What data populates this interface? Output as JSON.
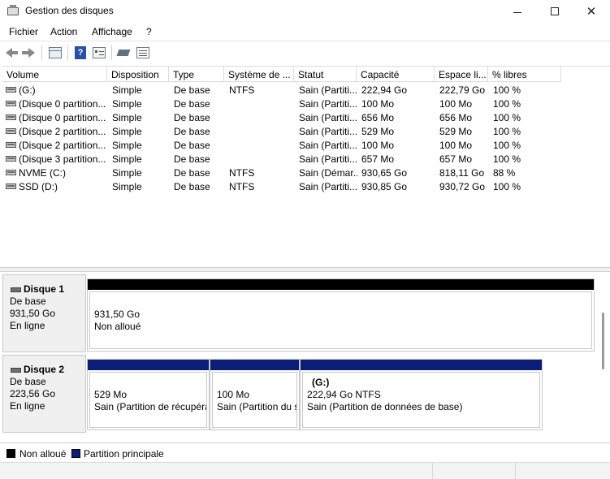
{
  "window": {
    "title": "Gestion des disques",
    "minimize_label": "—",
    "close_label": "✕"
  },
  "menu": [
    "Fichier",
    "Action",
    "Affichage",
    "?"
  ],
  "table": {
    "columns": [
      "Volume",
      "Disposition",
      "Type",
      "Système de ...",
      "Statut",
      "Capacité",
      "Espace li...",
      "% libres"
    ],
    "rows": [
      [
        "(G:)",
        "Simple",
        "De base",
        "NTFS",
        "Sain (Partiti...",
        "222,94 Go",
        "222,79 Go",
        "100 %"
      ],
      [
        "(Disque 0 partition...",
        "Simple",
        "De base",
        "",
        "Sain (Partiti...",
        "100 Mo",
        "100 Mo",
        "100 %"
      ],
      [
        "(Disque 0 partition...",
        "Simple",
        "De base",
        "",
        "Sain (Partiti...",
        "656 Mo",
        "656 Mo",
        "100 %"
      ],
      [
        "(Disque 2 partition...",
        "Simple",
        "De base",
        "",
        "Sain (Partiti...",
        "529 Mo",
        "529 Mo",
        "100 %"
      ],
      [
        "(Disque 2 partition...",
        "Simple",
        "De base",
        "",
        "Sain (Partiti...",
        "100 Mo",
        "100 Mo",
        "100 %"
      ],
      [
        "(Disque 3 partition...",
        "Simple",
        "De base",
        "",
        "Sain (Partiti...",
        "657 Mo",
        "657 Mo",
        "100 %"
      ],
      [
        "NVME (C:)",
        "Simple",
        "De base",
        "NTFS",
        "Sain (Démar...",
        "930,65 Go",
        "818,11 Go",
        "88 %"
      ],
      [
        "SSD (D:)",
        "Simple",
        "De base",
        "NTFS",
        "Sain (Partiti...",
        "930,85 Go",
        "930,72 Go",
        "100 %"
      ]
    ]
  },
  "disks": [
    {
      "name": "Disque 1",
      "type": "De base",
      "size": "931,50 Go",
      "status": "En ligne",
      "partitions": [
        {
          "title": "",
          "size": "931,50 Go",
          "desc": "Non alloué",
          "bar_color": "#000000"
        }
      ]
    },
    {
      "name": "Disque 2",
      "type": "De base",
      "size": "223,56 Go",
      "status": "En ligne",
      "partitions": [
        {
          "title": "",
          "size": "529 Mo",
          "desc": "Sain (Partition de récupéra",
          "bar_color": "#0a1e78"
        },
        {
          "title": "",
          "size": "100 Mo",
          "desc": "Sain (Partition du s",
          "bar_color": "#0a1e78"
        },
        {
          "title": "(G:)",
          "size": "222,94 Go NTFS",
          "desc": "Sain (Partition de données de base)",
          "bar_color": "#0a1e78"
        }
      ]
    }
  ],
  "legend": [
    {
      "label": "Non alloué",
      "color": "#000000"
    },
    {
      "label": "Partition principale",
      "color": "#0a1e78"
    }
  ],
  "toolbar_icons": [
    "back-arrow-icon",
    "forward-arrow-icon",
    "disk-list-icon",
    "help-icon",
    "properties-icon",
    "connect-icon",
    "list-view-icon"
  ]
}
